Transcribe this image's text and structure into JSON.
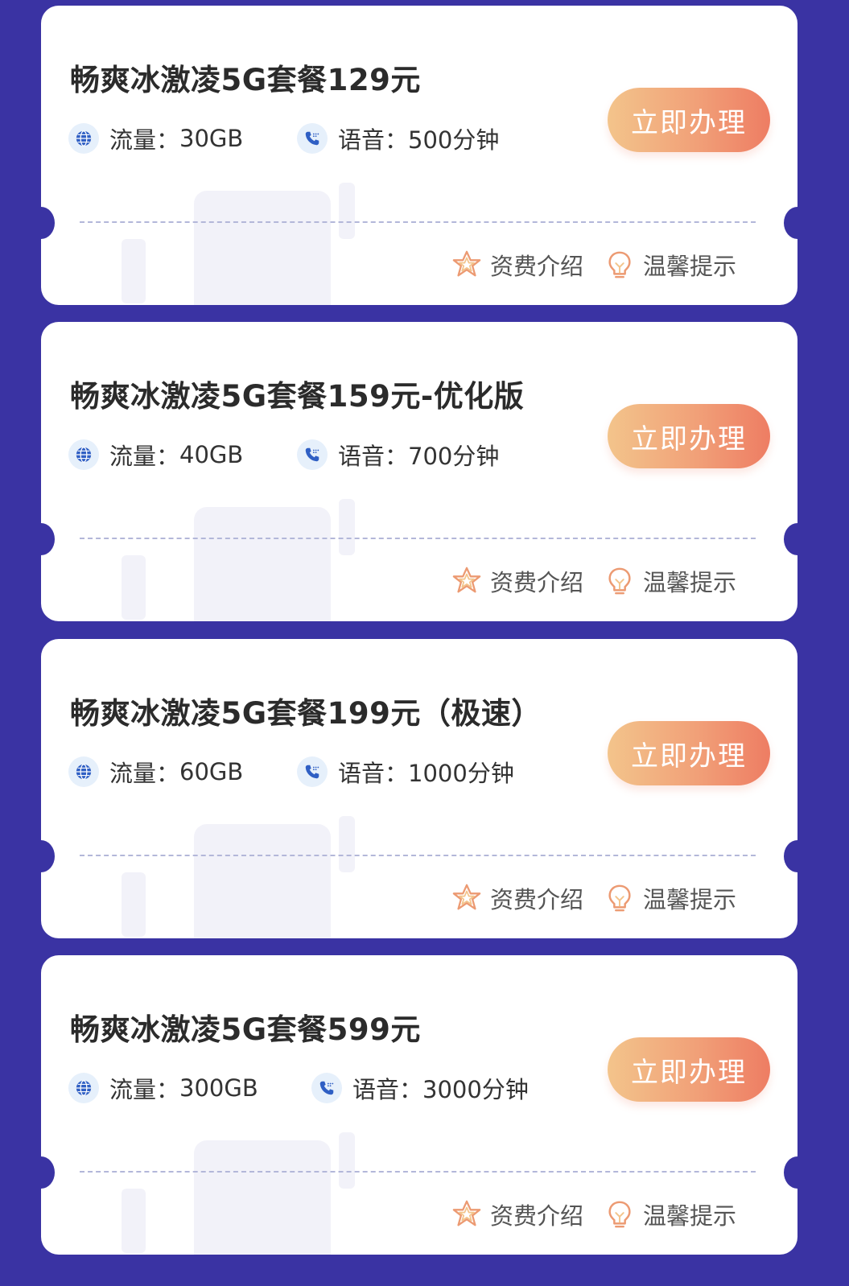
{
  "plans": [
    {
      "title": "畅爽冰激凌5G套餐129元",
      "data_label": "流量：",
      "data_value": "30GB",
      "voice_label": "语音：",
      "voice_value": "500分钟",
      "apply_label": "立即办理",
      "fee_label": "资费介绍",
      "tip_label": "温馨提示"
    },
    {
      "title": "畅爽冰激凌5G套餐159元-优化版",
      "data_label": "流量：",
      "data_value": "40GB",
      "voice_label": "语音：",
      "voice_value": "700分钟",
      "apply_label": "立即办理",
      "fee_label": "资费介绍",
      "tip_label": "温馨提示"
    },
    {
      "title": "畅爽冰激凌5G套餐199元（极速）",
      "data_label": "流量：",
      "data_value": "60GB",
      "voice_label": "语音：",
      "voice_value": "1000分钟",
      "apply_label": "立即办理",
      "fee_label": "资费介绍",
      "tip_label": "温馨提示"
    },
    {
      "title": "畅爽冰激凌5G套餐599元",
      "data_label": "流量：",
      "data_value": "300GB",
      "voice_label": "语音：",
      "voice_value": "3000分钟",
      "apply_label": "立即办理",
      "fee_label": "资费介绍",
      "tip_label": "温馨提示"
    }
  ],
  "icons": {
    "data": "globe-icon",
    "voice": "phone-icon",
    "fee": "star-icon",
    "tip": "lightbulb-icon"
  },
  "colors": {
    "page_bg": "#3a33a3",
    "card_bg": "#ffffff",
    "button_gradient_start": "#f3c48b",
    "button_gradient_end": "#ee7d63",
    "icon_blue": "#2f5fc4",
    "icon_orange": "#ec9a72"
  }
}
